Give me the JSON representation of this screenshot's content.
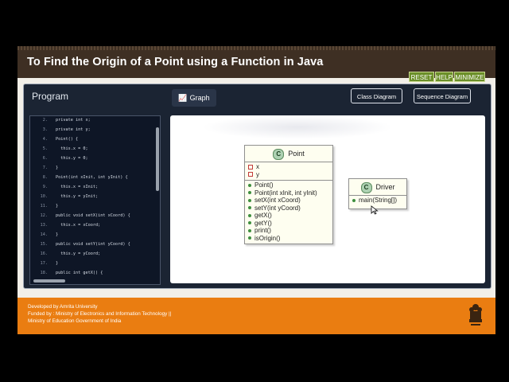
{
  "header": {
    "title": "To Find the Origin of a Point using a Function in Java",
    "controls": {
      "reset": "RESET",
      "help": "HELP",
      "minimize": "MINIMIZE"
    }
  },
  "workspace": {
    "program_label": "Program",
    "graph_tab": "Graph",
    "class_diagram_button": "Class Diagram",
    "sequence_diagram_button": "Sequence Diagram"
  },
  "code": {
    "lines": [
      {
        "n": "2.",
        "t": "private int x;"
      },
      {
        "n": "3.",
        "t": "private int y;"
      },
      {
        "n": "4.",
        "t": "Point() {"
      },
      {
        "n": "5.",
        "t": "  this.x = 0;"
      },
      {
        "n": "6.",
        "t": "  this.y = 0;"
      },
      {
        "n": "7.",
        "t": "}"
      },
      {
        "n": "8.",
        "t": "Point(int xInit, int yInit) {"
      },
      {
        "n": "9.",
        "t": "  this.x = xInit;"
      },
      {
        "n": "10.",
        "t": "  this.y = yInit;"
      },
      {
        "n": "11.",
        "t": "}"
      },
      {
        "n": "12.",
        "t": "public void setX(int xCoord) {"
      },
      {
        "n": "13.",
        "t": "  this.x = xCoord;"
      },
      {
        "n": "14.",
        "t": "}"
      },
      {
        "n": "15.",
        "t": "public void setY(int yCoord) {"
      },
      {
        "n": "16.",
        "t": "  this.y = yCoord;"
      },
      {
        "n": "17.",
        "t": "}"
      },
      {
        "n": "18.",
        "t": "public int getX() {"
      }
    ]
  },
  "diagram": {
    "point_class": {
      "name": "Point",
      "fields": [
        "x",
        "y"
      ],
      "methods": [
        "Point()",
        "Point(int xInit, int yInit)",
        "setX(int xCoord)",
        "setY(int yCoord)",
        "getX()",
        "getY()",
        "print()",
        "isOrigin()"
      ]
    },
    "driver_class": {
      "name": "Driver",
      "methods": [
        "main(String[])"
      ]
    }
  },
  "footer": {
    "line1": "Developed by Amrita University",
    "line2": "Funded by : Ministry of Electronics and Information Technology ||",
    "line3": "Ministry of Education Government of India"
  },
  "icons": {
    "graph_tab_icon": "chart-icon",
    "class_badge": "class-c-icon",
    "field_marker": "private-field-icon",
    "method_marker": "public-method-icon"
  },
  "colors": {
    "header_bg": "#3e2f23",
    "footer_bg": "#ea7d11",
    "workspace_bg": "#1b2433",
    "control_green": "#6b8f28"
  }
}
